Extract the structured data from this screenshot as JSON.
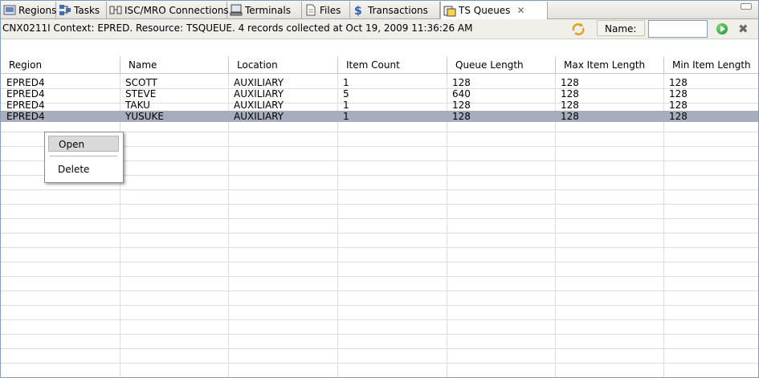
{
  "tabs": [
    {
      "label": "Regions",
      "icon": "regions-icon",
      "active": false
    },
    {
      "label": "Tasks",
      "icon": "tasks-icon",
      "active": false
    },
    {
      "label": "ISC/MRO Connections",
      "icon": "connections-icon",
      "active": false
    },
    {
      "label": "Terminals",
      "icon": "terminals-icon",
      "active": false
    },
    {
      "label": "Files",
      "icon": "files-icon",
      "active": false
    },
    {
      "label": "Transactions",
      "icon": "transactions-icon",
      "active": false
    },
    {
      "label": "TS Queues",
      "icon": "ts-queues-icon",
      "active": true
    }
  ],
  "toolbar": {
    "context_text": "CNX0211I Context: EPRED. Resource: TSQUEUE. 4 records collected at Oct 19, 2009 11:36:26 AM",
    "name_label": "Name:",
    "name_value": ""
  },
  "table": {
    "columns": [
      "Region",
      "Name",
      "Location",
      "Item Count",
      "Queue Length",
      "Max Item Length",
      "Min Item Length"
    ],
    "rows": [
      [
        "EPRED4",
        "SCOTT",
        "AUXILIARY",
        "1",
        "128",
        "128",
        "128"
      ],
      [
        "EPRED4",
        "STEVE",
        "AUXILIARY",
        "5",
        "640",
        "128",
        "128"
      ],
      [
        "EPRED4",
        "TAKU",
        "AUXILIARY",
        "1",
        "128",
        "128",
        "128"
      ],
      [
        "EPRED4",
        "YUSUKE",
        "AUXILIARY",
        "1",
        "128",
        "128",
        "128"
      ]
    ]
  },
  "context_menu": {
    "items": [
      "Open",
      "Delete"
    ]
  },
  "colors": {
    "selected_row": "#a8adbd",
    "accent": "#7f9db9"
  }
}
